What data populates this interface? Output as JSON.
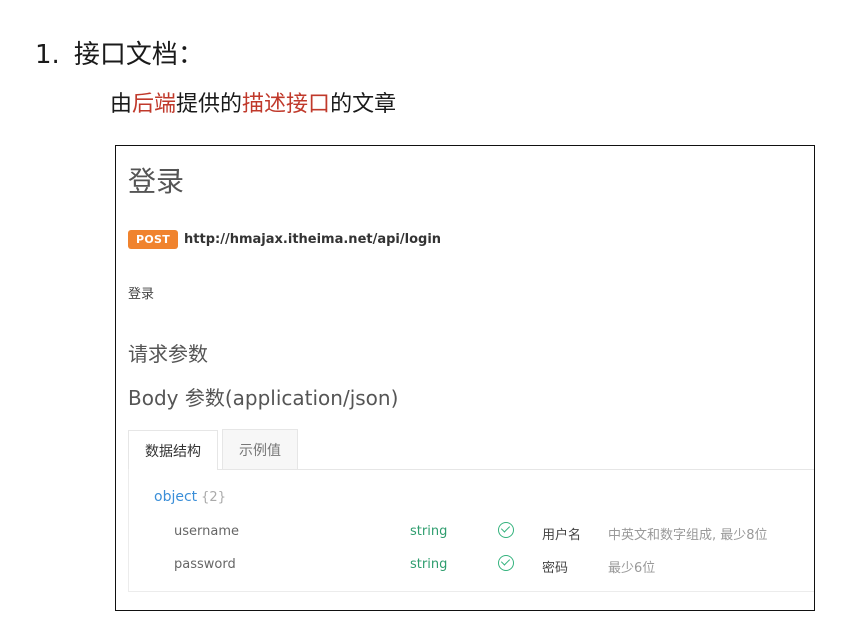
{
  "heading": {
    "number": "1.",
    "text": "接口文档："
  },
  "subline": {
    "part1": "由",
    "part2": "后端",
    "part3": "提供的",
    "part4": "描述接口",
    "part5": "的文章",
    "highlight_color": "#c0392b"
  },
  "api": {
    "title": "登录",
    "method": "POST",
    "method_color": "#f0832e",
    "url": "http://hmajax.itheima.net/api/login",
    "description": "登录",
    "request_params_title": "请求参数",
    "body_title": "Body 参数(application/json)"
  },
  "tabs": [
    {
      "label": "数据结构",
      "active": true
    },
    {
      "label": "示例值",
      "active": false
    }
  ],
  "schema": {
    "type": "object",
    "count": "{2}",
    "fields": [
      {
        "name": "username",
        "type": "string",
        "required_icon": "check-circle-icon",
        "title": "用户名",
        "desc": "中英文和数字组成, 最少8位"
      },
      {
        "name": "password",
        "type": "string",
        "required_icon": "check-circle-icon",
        "title": "密码",
        "desc": "最少6位"
      }
    ]
  }
}
